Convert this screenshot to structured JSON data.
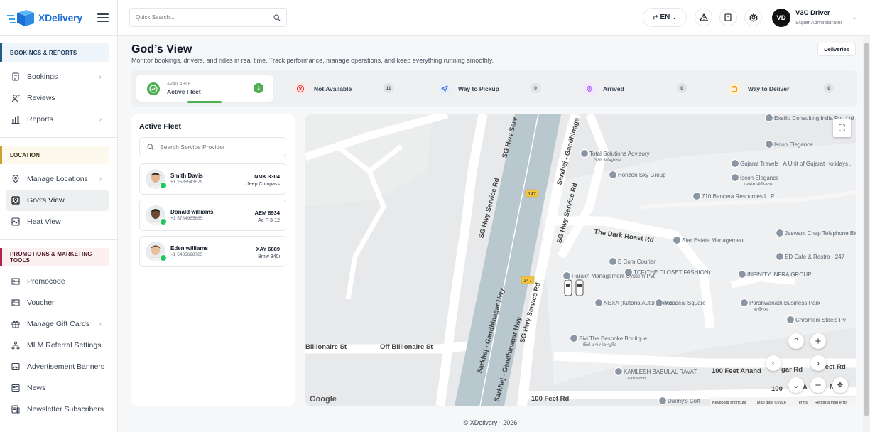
{
  "brand": {
    "name": "XDelivery"
  },
  "sidebar": {
    "sections": [
      {
        "title": "BOOKINGS & REPORTS",
        "items": [
          {
            "label": "Bookings",
            "icon": "list-icon",
            "chevron": true
          },
          {
            "label": "Reviews",
            "icon": "user-review-icon",
            "chevron": false
          },
          {
            "label": "Reports",
            "icon": "bar-chart-icon",
            "chevron": true
          }
        ]
      },
      {
        "title": "LOCATION",
        "items": [
          {
            "label": "Manage Locations",
            "icon": "location-pin-icon",
            "chevron": true
          },
          {
            "label": "God's View",
            "icon": "map-view-icon",
            "chevron": false,
            "active": true
          },
          {
            "label": "Heat View",
            "icon": "heat-map-icon",
            "chevron": false
          }
        ]
      },
      {
        "title": "PROMOTIONS & MARKETING TOOLS",
        "items": [
          {
            "label": "Promocode",
            "icon": "ticket-icon",
            "chevron": false
          },
          {
            "label": "Voucher",
            "icon": "voucher-icon",
            "chevron": false
          },
          {
            "label": "Manage Gift Cards",
            "icon": "gift-icon",
            "chevron": true
          },
          {
            "label": "MLM Referral Settings",
            "icon": "network-icon",
            "chevron": false
          },
          {
            "label": "Advertisement Banners",
            "icon": "image-icon",
            "chevron": false
          },
          {
            "label": "News",
            "icon": "news-icon",
            "chevron": false
          },
          {
            "label": "Newsletter Subscribers",
            "icon": "newsletter-icon",
            "chevron": false
          }
        ]
      }
    ]
  },
  "topbar": {
    "search_placeholder": "Quick Search...",
    "language": "EN",
    "user": {
      "initials": "VD",
      "name": "V3C Driver",
      "role": "Super Administrator"
    }
  },
  "page": {
    "title": "God’s View",
    "subtitle": "Monitor bookings, drivers, and rides in real time. Track performance, manage operations, and keep everything running smoothly.",
    "deliveries_button": "Deliveries"
  },
  "status_tabs": [
    {
      "caption": "AVAILABLE",
      "label": "Active Fleet",
      "count": "3",
      "active": true,
      "color": "#4caf50"
    },
    {
      "caption": "",
      "label": "Not Available",
      "count": "11",
      "active": false,
      "color": "#e53935"
    },
    {
      "caption": "",
      "label": "Way to Pickup",
      "count": "0",
      "active": false,
      "color": "#3b6fd8"
    },
    {
      "caption": "",
      "label": "Arrived",
      "count": "0",
      "active": false,
      "color": "#a855f7"
    },
    {
      "caption": "",
      "label": "Way to Deliver",
      "count": "0",
      "active": false,
      "color": "#f59e0b"
    }
  ],
  "fleet": {
    "title": "Active Fleet",
    "search_placeholder": "Search Service Provider",
    "drivers": [
      {
        "name": "Smith Davis",
        "phone": "+1 2586543579",
        "plate": "NMK 3304",
        "model": "Jeep Compass",
        "skin": "#e0b48f",
        "hair": "#3b2a1e"
      },
      {
        "name": "Donald williams",
        "phone": "+1 5784985685",
        "plate": "AEM 8934",
        "model": "Ac F-3-12",
        "skin": "#6b4630",
        "hair": "#1a1a1a"
      },
      {
        "name": "Eden williams",
        "phone": "+1 5485698785",
        "plate": "XAY 6889",
        "model": "Bmw 840i",
        "skin": "#e8bf9b",
        "hair": "#7a5230"
      }
    ]
  },
  "map": {
    "road_labels": [
      "SG Hwy Service Rd",
      "SG Hwy Serv",
      "Sarkhej - Gandhinaga",
      "Sarkhej - Gandhinagar Hwy",
      "SG Hwy Service Rd",
      "SG Hwy Service Rd",
      "Billionaire St",
      "Off Billionaire St",
      "The Dark Roast Rd",
      "100 Feet Anand",
      "gar Rd",
      "100 Feet Rd",
      "Feet Rd",
      "100",
      "A",
      "N",
      "Sarkhej - Gandhinagar Hwy"
    ],
    "shields": [
      "147",
      "147"
    ],
    "places": [
      {
        "name": "Total Solutions Advisory",
        "sub": "ટોટલ સોલ્યુશન્સ"
      },
      {
        "name": "Horizon Sky Group",
        "sub": ""
      },
      {
        "name": "Star Estate Management",
        "sub": ""
      },
      {
        "name": "E Com Courier",
        "sub": ""
      },
      {
        "name": "TCF(THE CLOSET FASHION)",
        "sub": ""
      },
      {
        "name": "Parakh Management System Pvt",
        "sub": ""
      },
      {
        "name": "NEXA (Kataria Automobiles...",
        "sub": ""
      },
      {
        "name": "Mondeal Square",
        "sub": ""
      },
      {
        "name": "Sivi The Bespoke Boutique",
        "sub": "શિવી ધ બેસ્પોક બુટીક"
      },
      {
        "name": "KAMLESH BABULAL RAVAT",
        "sub": "Fast Food"
      },
      {
        "name": "Danny's Coff",
        "sub": ""
      },
      {
        "name": "Exsilio Consulting India Pvt. Ltd",
        "sub": ""
      },
      {
        "name": "Iscon Elegance",
        "sub": ""
      },
      {
        "name": "Gujarat Travels : A Unit of Gujarat Holidays...",
        "sub": ""
      },
      {
        "name": "Iscon Elegance",
        "sub": "ઇસ્કોન એલિગન્સ"
      },
      {
        "name": "710 Bencera Resources LLP",
        "sub": ""
      },
      {
        "name": "Jaswant Chap Telephone Bidi",
        "sub": ""
      },
      {
        "name": "ED Cafe & Restro - 247",
        "sub": ""
      },
      {
        "name": "INFINITY INFRA GROUP",
        "sub": ""
      },
      {
        "name": "Parshwanath Business Park",
        "sub": "પાર્શ્વનાથ"
      },
      {
        "name": "Chromeni Steels Pv",
        "sub": ""
      }
    ],
    "google": "Google",
    "attrib": [
      "Keyboard shortcuts",
      "Map data ©2026",
      "Terms",
      "Report a map error"
    ]
  },
  "footer": "© XDelivery - 2026",
  "colors": {
    "accent_green": "#4caf50",
    "brand_blue": "#1d6fd8"
  }
}
